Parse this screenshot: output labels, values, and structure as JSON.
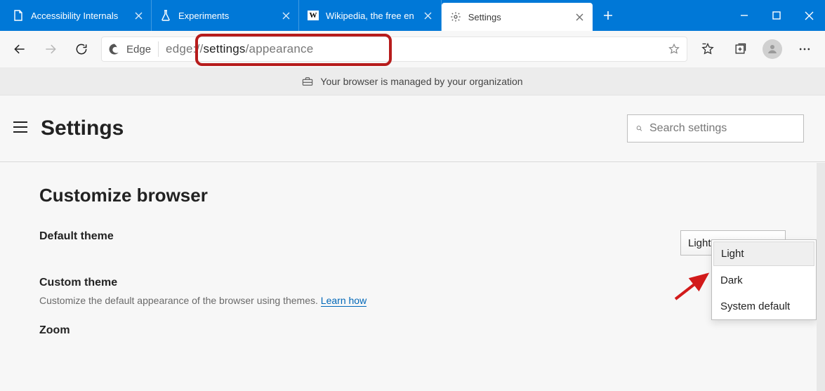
{
  "tabs": [
    {
      "label": "Accessibility Internals",
      "icon": "page"
    },
    {
      "label": "Experiments",
      "icon": "flask"
    },
    {
      "label": "Wikipedia, the free en",
      "icon": "wiki"
    },
    {
      "label": "Settings",
      "icon": "gear",
      "active": true
    }
  ],
  "toolbar": {
    "site_label": "Edge",
    "url_prefix": "edge://",
    "url_strong": "settings",
    "url_suffix": "/appearance"
  },
  "infobar": {
    "text": "Your browser is managed by your organization"
  },
  "settings": {
    "title": "Settings",
    "search_placeholder": "Search settings",
    "section_title": "Customize browser",
    "rows": {
      "theme_label": "Default theme",
      "custom_label": "Custom theme",
      "custom_sub": "Customize the default appearance of the browser using themes. ",
      "custom_link": "Learn how",
      "zoom_label": "Zoom"
    },
    "theme_select": {
      "value": "Light",
      "options": [
        "Light",
        "Dark",
        "System default"
      ]
    }
  }
}
